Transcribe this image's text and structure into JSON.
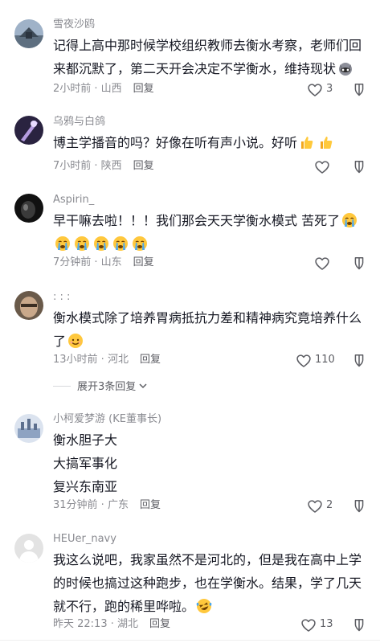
{
  "comments": [
    {
      "user": "雪夜沙鸥",
      "text": "记得上高中那时候学校组织教师去衡水考察，老师们回来都沉默了，第二天开会决定不学衡水，维持现状",
      "time": "2小时前 · 山西",
      "reply": "回复",
      "likes": "3"
    },
    {
      "user": "乌鸦与白鸽",
      "text": "博主学播音的吗？好像在听有声小说。好听",
      "time": "7小时前 · 陕西",
      "reply": "回复",
      "likes": ""
    },
    {
      "user": "Aspirin_",
      "text": "早干嘛去啦！！！我们那会天天学衡水模式 苦死了",
      "time": "7分钟前 · 山东",
      "reply": "回复",
      "likes": ""
    },
    {
      "user": ": : :",
      "text": "衡水模式除了培养胃病抵抗力差和精神病究竟培养什么了",
      "time": "13小时前 · 河北",
      "reply": "回复",
      "likes": "110"
    },
    {
      "user": "小柯爱梦游 (KE董事长)",
      "lines": [
        "衡水胆子大",
        "大搞军事化",
        "复兴东南亚"
      ],
      "time": "31分钟前 · 广东",
      "reply": "回复",
      "likes": "2"
    },
    {
      "user": "HEUer_navy",
      "text": "我这么说吧，我家虽然不是河北的，但是我在高中上学的时候也搞过这种跑步，也在学衡水。结果，学了几天就不行，跑的稀里哗啦。",
      "time": "昨天 22:13 · 湖北",
      "reply": "回复",
      "likes": "13"
    }
  ],
  "expand_replies": "展开3条回复",
  "icons": {
    "like": "heart-outline-icon",
    "dislike": "thumb-down-outline-icon",
    "expand": "chevron-down-icon"
  },
  "colors": {
    "text": "#161823",
    "muted": "#8a8b91",
    "icon": "#5c5d63"
  }
}
